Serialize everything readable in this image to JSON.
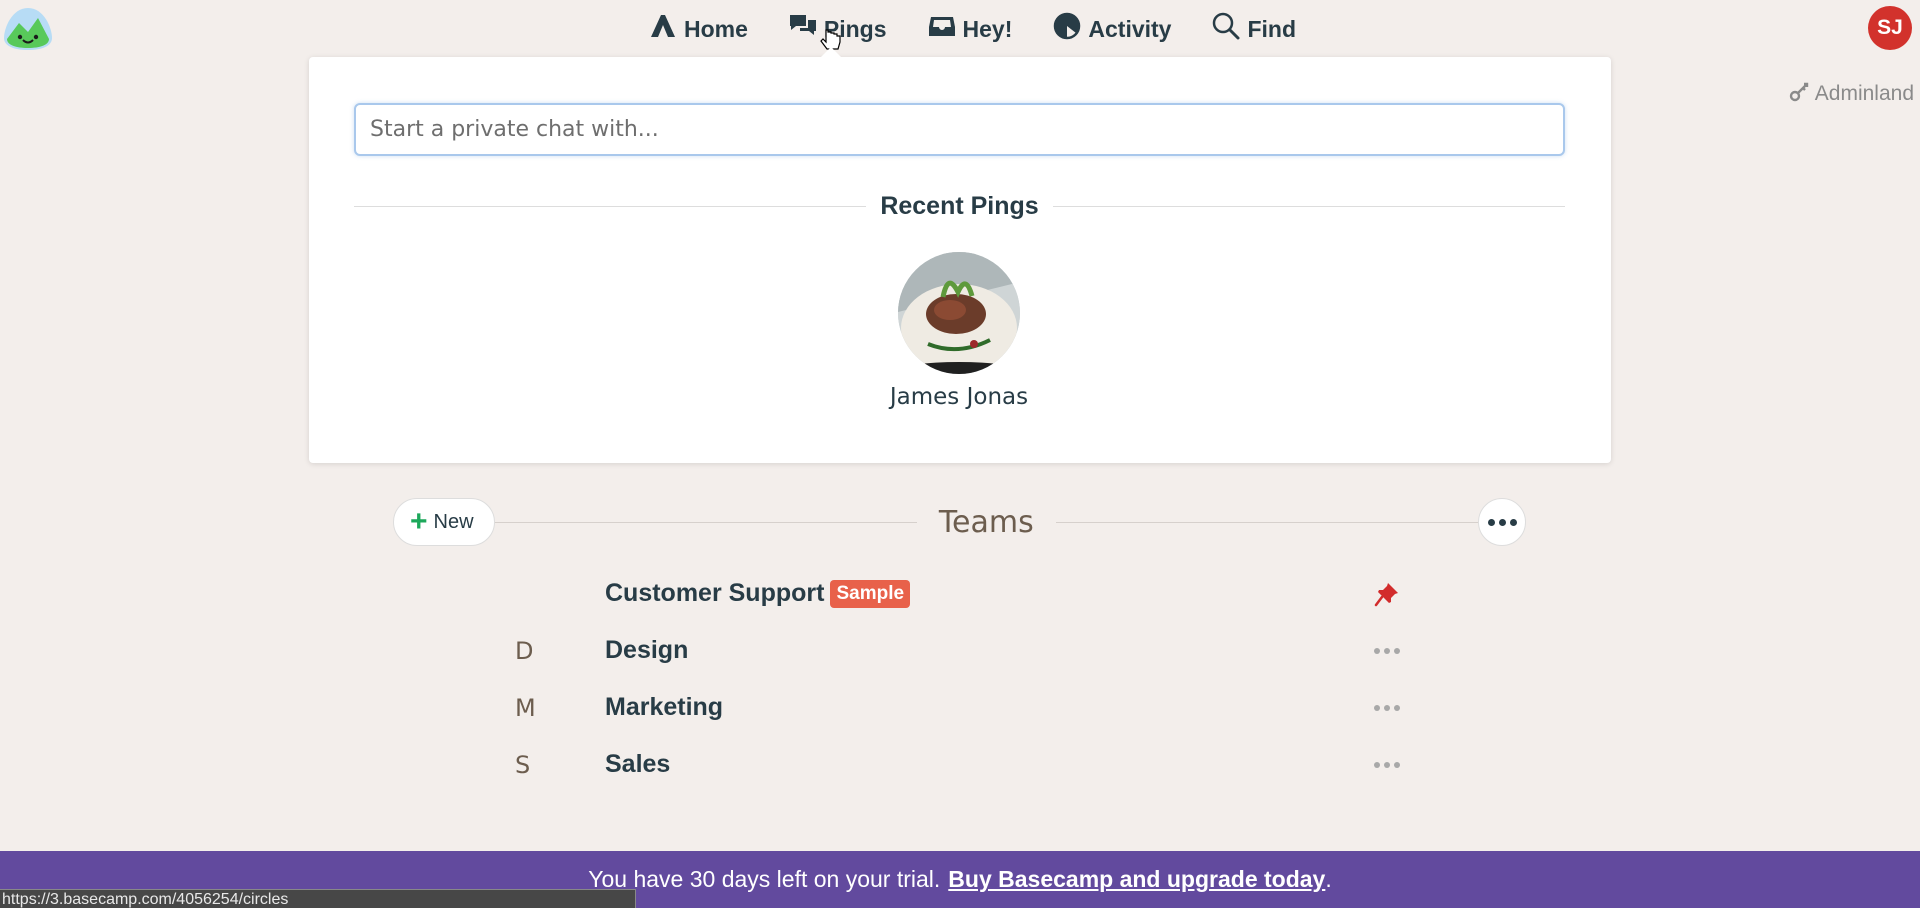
{
  "app": {
    "logo": "basecamp-logo"
  },
  "nav": {
    "items": [
      {
        "label": "Home",
        "icon": "home-icon"
      },
      {
        "label": "Pings",
        "icon": "pings-icon"
      },
      {
        "label": "Hey!",
        "icon": "hey-inbox-icon"
      },
      {
        "label": "Activity",
        "icon": "activity-icon"
      },
      {
        "label": "Find",
        "icon": "search-icon"
      }
    ]
  },
  "user": {
    "initials": "SJ",
    "avatar_color": "#d2322c"
  },
  "adminland": {
    "label": "Adminland",
    "icon": "key-icon"
  },
  "pings_popover": {
    "input_placeholder": "Start a private chat with...",
    "input_value": "",
    "recent_heading": "Recent Pings",
    "recent": [
      {
        "name": "James Jonas"
      }
    ]
  },
  "teams": {
    "new_label": "New",
    "title": "Teams",
    "items": [
      {
        "initial": "",
        "name": "Customer Support",
        "badge": "Sample",
        "action": "pin-icon"
      },
      {
        "initial": "D",
        "name": "Design",
        "badge": "",
        "action": "more-icon"
      },
      {
        "initial": "M",
        "name": "Marketing",
        "badge": "",
        "action": "more-icon"
      },
      {
        "initial": "S",
        "name": "Sales",
        "badge": "",
        "action": "more-icon"
      }
    ]
  },
  "trial": {
    "message": "You have 30 days left on your trial.",
    "link": "Buy Basecamp and upgrade today",
    "suffix": "."
  },
  "status_bar": {
    "url": "https://3.basecamp.com/4056254/circles"
  },
  "colors": {
    "banner": "#624a9e",
    "badge": "#e8614a",
    "accent_green": "#1da85b"
  }
}
